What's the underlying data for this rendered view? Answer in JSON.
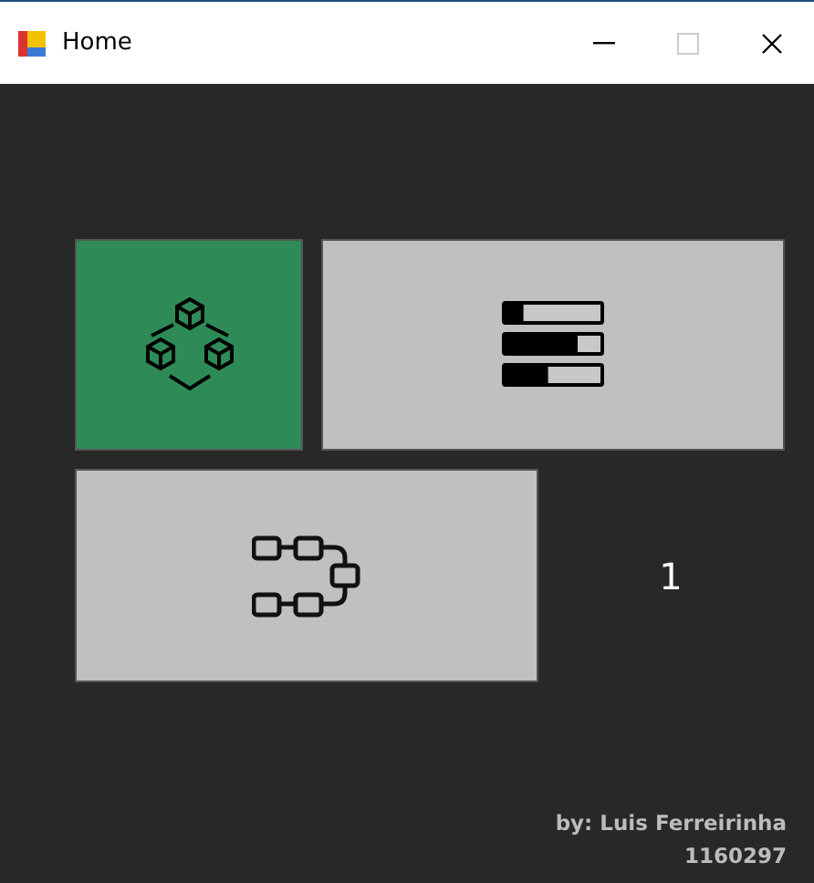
{
  "window": {
    "title": "Home"
  },
  "tiles": [
    {
      "kind": "modules",
      "selected": true
    },
    {
      "kind": "bars",
      "selected": false
    },
    {
      "kind": "flow",
      "selected": false
    }
  ],
  "counter": "1",
  "footer": {
    "author": "by: Luis Ferreirinha",
    "id": "1160297"
  }
}
